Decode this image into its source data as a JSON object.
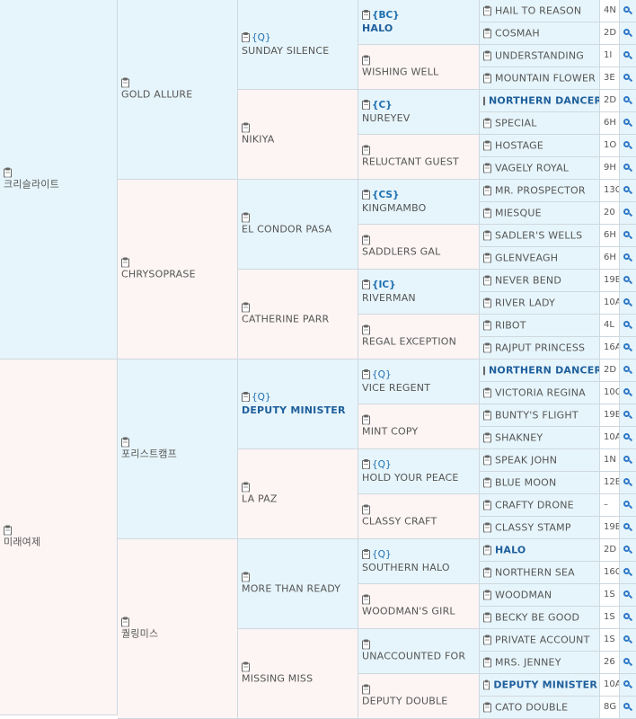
{
  "gen1": [
    {
      "name": "크리슬라이트",
      "color": "blue"
    },
    {
      "name": "미래여제",
      "color": "pink"
    }
  ],
  "gen2": [
    {
      "name": "GOLD ALLURE",
      "color": "blue"
    },
    {
      "name": "CHRYSOPRASE",
      "color": "pink"
    },
    {
      "name": "포리스트캠프",
      "color": "blue"
    },
    {
      "name": "퀄링미스",
      "color": "pink"
    }
  ],
  "gen3": [
    {
      "name": "SUNDAY SILENCE",
      "tag": "{Q}",
      "color": "blue"
    },
    {
      "name": "NIKIYA",
      "color": "pink"
    },
    {
      "name": "EL CONDOR PASA",
      "color": "blue"
    },
    {
      "name": "CATHERINE PARR",
      "color": "pink"
    },
    {
      "name": "DEPUTY MINISTER",
      "tag": "{Q}",
      "bold": true,
      "color": "blue"
    },
    {
      "name": "LA PAZ",
      "color": "pink"
    },
    {
      "name": "MORE THAN READY",
      "color": "blue"
    },
    {
      "name": "MISSING MISS",
      "color": "pink"
    }
  ],
  "gen4": [
    {
      "name": "HALO",
      "tag": "{BC}",
      "bold": true,
      "tagBold": true,
      "color": "blue"
    },
    {
      "name": "WISHING WELL",
      "color": "pink"
    },
    {
      "name": "NUREYEV",
      "tag": "{C}",
      "tagBold": true,
      "color": "blue"
    },
    {
      "name": "RELUCTANT GUEST",
      "color": "pink"
    },
    {
      "name": "KINGMAMBO",
      "tag": "{CS}",
      "tagBold": true,
      "color": "blue"
    },
    {
      "name": "SADDLERS GAL",
      "color": "pink"
    },
    {
      "name": "RIVERMAN",
      "tag": "{IC}",
      "tagBold": true,
      "color": "blue"
    },
    {
      "name": "REGAL EXCEPTION",
      "color": "pink"
    },
    {
      "name": "VICE REGENT",
      "tag": "{Q}",
      "color": "blue"
    },
    {
      "name": "MINT COPY",
      "color": "pink"
    },
    {
      "name": "HOLD YOUR PEACE",
      "tag": "{Q}",
      "color": "blue"
    },
    {
      "name": "CLASSY CRAFT",
      "color": "pink"
    },
    {
      "name": "SOUTHERN HALO",
      "tag": "{Q}",
      "color": "blue"
    },
    {
      "name": "WOODMAN'S GIRL",
      "color": "pink"
    },
    {
      "name": "UNACCOUNTED FOR",
      "color": "blue"
    },
    {
      "name": "DEPUTY DOUBLE",
      "color": "pink"
    }
  ],
  "gen5": [
    {
      "name": "HAIL TO REASON",
      "code": "4N"
    },
    {
      "name": "COSMAH",
      "code": "2D"
    },
    {
      "name": "UNDERSTANDING",
      "code": "1I"
    },
    {
      "name": "MOUNTAIN FLOWER",
      "code": "3E"
    },
    {
      "name": "NORTHERN DANCER",
      "code": "2D",
      "bold": true
    },
    {
      "name": "SPECIAL",
      "code": "6H"
    },
    {
      "name": "HOSTAGE",
      "code": "1O"
    },
    {
      "name": "VAGELY ROYAL",
      "code": "9H"
    },
    {
      "name": "MR. PROSPECTOR",
      "code": "13C"
    },
    {
      "name": "MIESQUE",
      "code": "20"
    },
    {
      "name": "SADLER'S WELLS",
      "code": "6H"
    },
    {
      "name": "GLENVEAGH",
      "code": "6H"
    },
    {
      "name": "NEVER BEND",
      "code": "19B"
    },
    {
      "name": "RIVER LADY",
      "code": "10A"
    },
    {
      "name": "RIBOT",
      "code": "4L"
    },
    {
      "name": "RAJPUT PRINCESS",
      "code": "16A"
    },
    {
      "name": "NORTHERN DANCER",
      "code": "2D",
      "bold": true
    },
    {
      "name": "VICTORIA REGINA",
      "code": "10C"
    },
    {
      "name": "BUNTY'S FLIGHT",
      "code": "19B"
    },
    {
      "name": "SHAKNEY",
      "code": "10A"
    },
    {
      "name": "SPEAK JOHN",
      "code": "1N"
    },
    {
      "name": "BLUE MOON",
      "code": "12B"
    },
    {
      "name": "CRAFTY DRONE",
      "code": "–"
    },
    {
      "name": "CLASSY STAMP",
      "code": "19B"
    },
    {
      "name": "HALO",
      "code": "2D",
      "bold": true
    },
    {
      "name": "NORTHERN SEA",
      "code": "16C"
    },
    {
      "name": "WOODMAN",
      "code": "1S"
    },
    {
      "name": "BECKY BE GOOD",
      "code": "1S"
    },
    {
      "name": "PRIVATE ACCOUNT",
      "code": "1S"
    },
    {
      "name": "MRS. JENNEY",
      "code": "26"
    },
    {
      "name": "DEPUTY MINISTER",
      "code": "10A",
      "bold": true
    },
    {
      "name": "CATO DOUBLE",
      "code": "8G"
    }
  ],
  "colors": {
    "blue": "#e6f5fb",
    "pink": "#fcf5f4",
    "link": "#1f5f9c",
    "border": "#cfd8df"
  },
  "icons": {
    "clipboard": "clipboard-icon",
    "search": "search-icon"
  }
}
